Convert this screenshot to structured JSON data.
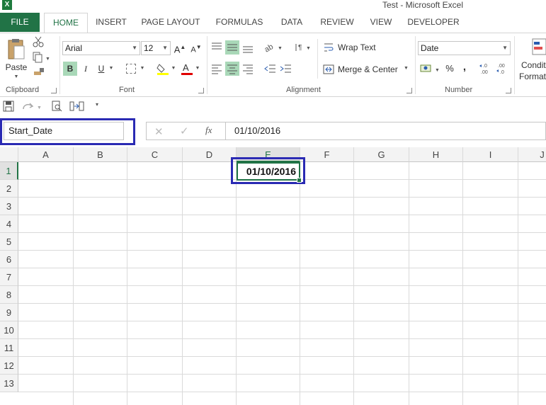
{
  "window": {
    "title": "Test - Microsoft Excel",
    "app_icon_letter": "X"
  },
  "tabs": [
    {
      "label": "FILE"
    },
    {
      "label": "HOME"
    },
    {
      "label": "INSERT"
    },
    {
      "label": "PAGE LAYOUT"
    },
    {
      "label": "FORMULAS"
    },
    {
      "label": "DATA"
    },
    {
      "label": "REVIEW"
    },
    {
      "label": "VIEW"
    },
    {
      "label": "DEVELOPER"
    }
  ],
  "ribbon": {
    "clipboard": {
      "label": "Clipboard",
      "paste_label": "Paste"
    },
    "font": {
      "label": "Font",
      "font_name": "Arial",
      "font_size": "12",
      "bold": "B",
      "italic": "I",
      "underline": "U"
    },
    "alignment": {
      "label": "Alignment",
      "wrap_text": "Wrap Text",
      "merge_center": "Merge & Center"
    },
    "number": {
      "label": "Number",
      "format": "Date",
      "percent": "%",
      "comma": ",",
      "inc_decimal": "←.0\n.00",
      "dec_decimal": ".00\n→.0"
    },
    "styles": {
      "cond_format_line1": "Conditi",
      "cond_format_line2": "Formatt"
    }
  },
  "formula_bar": {
    "name_box": "Start_Date",
    "formula": "01/10/2016",
    "cancel": "✕",
    "enter": "✓",
    "fx": "fx"
  },
  "columns": [
    "A",
    "B",
    "C",
    "D",
    "E",
    "F",
    "G",
    "H",
    "I",
    "J"
  ],
  "rows": [
    "1",
    "2",
    "3",
    "4",
    "5",
    "6",
    "7",
    "8",
    "9",
    "10",
    "11",
    "12",
    "13"
  ],
  "active_cell": {
    "address": "E1",
    "value": "01/10/2016"
  },
  "colors": {
    "accent": "#217346",
    "highlight": "#2a2ab3"
  }
}
